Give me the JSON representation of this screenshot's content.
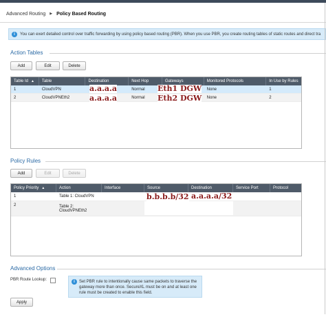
{
  "breadcrumb": {
    "parent": "Advanced Routing",
    "current": "Policy Based Routing"
  },
  "banner": {
    "icon": "info-icon",
    "text": "You can exert detailed control over traffic forwarding by using policy based routing (PBR). When you use PBR, you create routing tables of static routes and direct tra"
  },
  "action_tables": {
    "title": "Action Tables",
    "buttons": {
      "add": "Add",
      "edit": "Edit",
      "delete": "Delete"
    },
    "columns": [
      "Table Id",
      "Table",
      "Destination",
      "Next Hop",
      "Gateways",
      "Monitored Protocols",
      "In Use by Rules"
    ],
    "sort_indicator": "▲",
    "rows": [
      {
        "id": "1",
        "table": "CloudVPN",
        "destination": "a.a.a.a",
        "next_hop": "Normal",
        "gateways": "Eth1 DGW",
        "monitored": "None",
        "in_use": "1"
      },
      {
        "id": "2",
        "table": "CloudVPNEth2",
        "destination": "a.a.a.a",
        "next_hop": "Normal",
        "gateways": "Eth2 DGW",
        "monitored": "None",
        "in_use": "2"
      }
    ]
  },
  "policy_rules": {
    "title": "Policy Rules",
    "buttons": {
      "add": "Add",
      "edit": "Edit",
      "delete": "Delete"
    },
    "columns": [
      "Policy Priority",
      "Action",
      "Interface",
      "Source",
      "Destination",
      "Service Port",
      "Protocol"
    ],
    "sort_indicator": "▲",
    "rows": [
      {
        "priority": "1",
        "action": "Table 1: CloudVPN",
        "action_line2": "",
        "interface": "",
        "source": "b.b.b.b/32",
        "destination": "a.a.a.a/32",
        "service_port": "",
        "protocol": ""
      },
      {
        "priority": "2",
        "action": "Table 2:",
        "action_line2": "CloudVPNEth2",
        "interface": "",
        "source": "",
        "destination": "",
        "service_port": "",
        "protocol": ""
      }
    ]
  },
  "advanced": {
    "title": "Advanced Options",
    "pbr_route_lookup_label": "PBR Route Lookup:",
    "pbr_route_lookup_checked": false,
    "tip": "Set PBR rule to intentionally cause same packets to traverse the gateway more than once. SecureXL must be on and at least one rule must be created to enable this field."
  },
  "apply_label": "Apply",
  "colors": {
    "accent": "#2b6aa5",
    "header": "#4f5b69",
    "selected_row": "#d4eafb",
    "info_bg": "#d7ebf9",
    "annotation": "#8b1c1c"
  }
}
